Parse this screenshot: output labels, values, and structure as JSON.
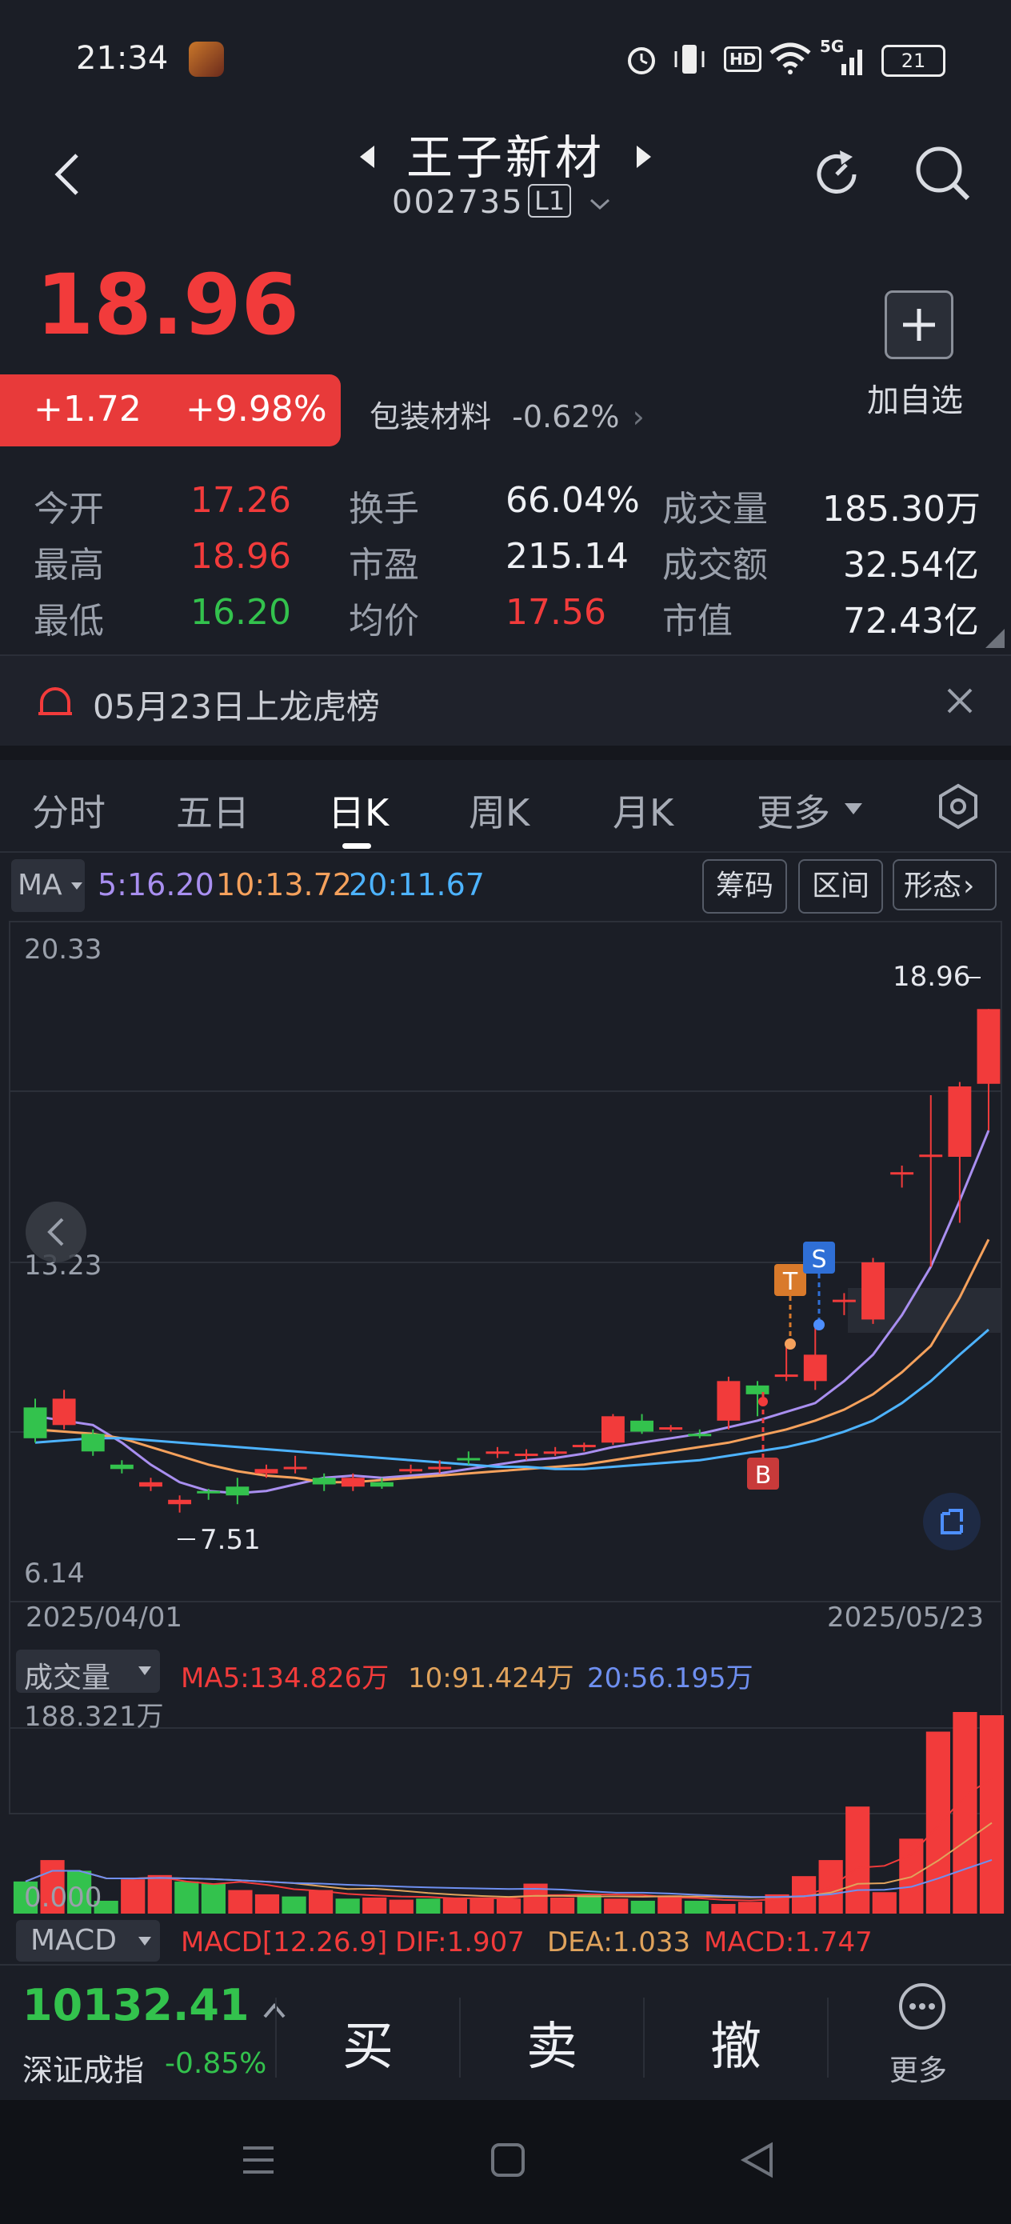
{
  "status_bar": {
    "time": "21:34",
    "network_label": "5G",
    "battery": "21",
    "hd_label": "HD"
  },
  "header": {
    "stock_name": "王子新材",
    "stock_code": "002735",
    "level_badge": "L1"
  },
  "quote": {
    "price": "18.96",
    "change": "+1.72",
    "change_pct": "+9.98%",
    "sector_name": "包装材料",
    "sector_change": "-0.62%",
    "add_watch_label": "加自选"
  },
  "stats": {
    "open_label": "今开",
    "open": "17.26",
    "turnover_label": "换手",
    "turnover": "66.04%",
    "volume_label": "成交量",
    "volume": "185.30万",
    "high_label": "最高",
    "high": "18.96",
    "pe_label": "市盈",
    "pe": "215.14",
    "amount_label": "成交额",
    "amount": "32.54亿",
    "low_label": "最低",
    "low": "16.20",
    "avg_label": "均价",
    "avg": "17.56",
    "mcap_label": "市值",
    "mcap": "72.43亿"
  },
  "notice": {
    "text": "05月23日上龙虎榜"
  },
  "tabs": [
    "分时",
    "五日",
    "日K",
    "周K",
    "月K",
    "更多"
  ],
  "active_tab": "日K",
  "ma_bar": {
    "selector": "MA",
    "ma5": "5:16.20",
    "ma10": "10:13.72",
    "ma20": "20:11.67",
    "btn_chips": "筹码",
    "btn_range": "区间",
    "btn_pattern": "形态"
  },
  "kline": {
    "y_top": "20.33",
    "y_mid": "13.23",
    "y_bottom": "6.14",
    "high_mark": "18.96",
    "low_mark": "7.51",
    "date_start": "2025/04/01",
    "date_end": "2025/05/23",
    "marker_t": "T",
    "marker_s": "S",
    "marker_b": "B"
  },
  "volume_panel": {
    "selector": "成交量",
    "ma5": "MA5:134.826万",
    "ma10": "10:91.424万",
    "ma20": "20:56.195万",
    "top_value": "188.321万",
    "bottom_value": "0.000"
  },
  "macd_panel": {
    "selector": "MACD",
    "params": "MACD[12.26.9]",
    "dif": "DIF:1.907",
    "dea": "DEA:1.033",
    "macd": "MACD:1.747"
  },
  "index_bar": {
    "value": "10132.41",
    "name": "深证成指",
    "change": "-0.85%"
  },
  "actions": {
    "buy": "买",
    "sell": "卖",
    "cancel": "撤",
    "more": "更多"
  },
  "colors": {
    "up": "#f23b3b",
    "down": "#33c24d",
    "ma5": "#a98ff0",
    "ma10": "#f5a15c",
    "ma20": "#4db3ff",
    "background": "#1b1e26"
  },
  "chart_data": {
    "type": "candlestick",
    "title": "",
    "x_range": [
      "2025/04/01",
      "2025/05/23"
    ],
    "ylim": [
      6.14,
      20.33
    ],
    "candles": [
      {
        "o": 9.9,
        "c": 9.2,
        "h": 10.1,
        "l": 9.1
      },
      {
        "o": 9.5,
        "c": 10.1,
        "h": 10.3,
        "l": 9.4
      },
      {
        "o": 9.3,
        "c": 8.9,
        "h": 9.4,
        "l": 8.8
      },
      {
        "o": 8.6,
        "c": 8.5,
        "h": 8.7,
        "l": 8.4
      },
      {
        "o": 8.1,
        "c": 8.2,
        "h": 8.3,
        "l": 8.0
      },
      {
        "o": 7.7,
        "c": 7.8,
        "h": 7.9,
        "l": 7.51
      },
      {
        "o": 8.0,
        "c": 7.95,
        "h": 8.05,
        "l": 7.8
      },
      {
        "o": 8.1,
        "c": 7.9,
        "h": 8.3,
        "l": 7.7
      },
      {
        "o": 8.4,
        "c": 8.5,
        "h": 8.6,
        "l": 8.3
      },
      {
        "o": 8.5,
        "c": 8.55,
        "h": 8.8,
        "l": 8.4
      },
      {
        "o": 8.3,
        "c": 8.15,
        "h": 8.4,
        "l": 8.0
      },
      {
        "o": 8.1,
        "c": 8.3,
        "h": 8.4,
        "l": 8.0
      },
      {
        "o": 8.2,
        "c": 8.1,
        "h": 8.3,
        "l": 8.05
      },
      {
        "o": 8.45,
        "c": 8.5,
        "h": 8.6,
        "l": 8.4
      },
      {
        "o": 8.5,
        "c": 8.55,
        "h": 8.7,
        "l": 8.4
      },
      {
        "o": 8.75,
        "c": 8.7,
        "h": 8.9,
        "l": 8.6
      },
      {
        "o": 8.85,
        "c": 8.9,
        "h": 9.0,
        "l": 8.75
      },
      {
        "o": 8.8,
        "c": 8.85,
        "h": 8.95,
        "l": 8.7
      },
      {
        "o": 8.85,
        "c": 8.9,
        "h": 9.0,
        "l": 8.8
      },
      {
        "o": 9.0,
        "c": 9.05,
        "h": 9.1,
        "l": 8.9
      },
      {
        "o": 9.1,
        "c": 9.7,
        "h": 9.75,
        "l": 9.05
      },
      {
        "o": 9.6,
        "c": 9.35,
        "h": 9.75,
        "l": 9.3
      },
      {
        "o": 9.4,
        "c": 9.45,
        "h": 9.5,
        "l": 9.35
      },
      {
        "o": 9.3,
        "c": 9.25,
        "h": 9.4,
        "l": 9.2
      },
      {
        "o": 9.6,
        "c": 10.5,
        "h": 10.6,
        "l": 9.4
      },
      {
        "o": 10.4,
        "c": 10.2,
        "h": 10.5,
        "l": 9.7
      },
      {
        "o": 10.6,
        "c": 10.65,
        "h": 11.4,
        "l": 10.5
      },
      {
        "o": 10.5,
        "c": 11.1,
        "h": 11.8,
        "l": 10.3
      },
      {
        "o": 12.3,
        "c": 12.35,
        "h": 12.5,
        "l": 12.0
      },
      {
        "o": 11.9,
        "c": 13.2,
        "h": 13.3,
        "l": 11.8
      },
      {
        "o": 15.2,
        "c": 15.25,
        "h": 15.4,
        "l": 14.9
      },
      {
        "o": 15.6,
        "c": 15.65,
        "h": 17.0,
        "l": 13.1
      },
      {
        "o": 15.6,
        "c": 17.2,
        "h": 17.3,
        "l": 14.1
      },
      {
        "o": 17.26,
        "c": 18.96,
        "h": 18.96,
        "l": 16.2
      }
    ],
    "series": [
      {
        "name": "MA5",
        "values": [
          9.7,
          9.6,
          9.5,
          9.1,
          8.6,
          8.2,
          8.0,
          7.95,
          8.0,
          8.15,
          8.3,
          8.35,
          8.3,
          8.35,
          8.4,
          8.5,
          8.6,
          8.7,
          8.75,
          8.85,
          9.0,
          9.1,
          9.2,
          9.3,
          9.45,
          9.6,
          9.8,
          10.0,
          10.5,
          11.1,
          12.0,
          13.1,
          14.6,
          16.2
        ]
      },
      {
        "name": "MA10",
        "values": [
          9.4,
          9.35,
          9.3,
          9.2,
          9.0,
          8.8,
          8.6,
          8.45,
          8.35,
          8.3,
          8.2,
          8.2,
          8.25,
          8.3,
          8.35,
          8.4,
          8.45,
          8.5,
          8.55,
          8.6,
          8.7,
          8.8,
          8.9,
          9.0,
          9.1,
          9.25,
          9.4,
          9.6,
          9.85,
          10.2,
          10.7,
          11.3,
          12.4,
          13.72
        ]
      },
      {
        "name": "MA20",
        "values": [
          9.1,
          9.15,
          9.2,
          9.2,
          9.15,
          9.1,
          9.05,
          9.0,
          8.95,
          8.9,
          8.85,
          8.8,
          8.75,
          8.7,
          8.65,
          8.6,
          8.55,
          8.55,
          8.5,
          8.5,
          8.55,
          8.6,
          8.65,
          8.7,
          8.8,
          8.9,
          9.0,
          9.15,
          9.35,
          9.6,
          10.0,
          10.5,
          11.1,
          11.67
        ]
      }
    ],
    "volume": [
      30,
      50,
      40,
      12,
      32,
      36,
      30,
      28,
      22,
      18,
      16,
      22,
      14,
      15,
      13,
      14,
      15,
      15,
      14,
      28,
      15,
      18,
      14,
      12,
      17,
      12,
      9,
      11,
      18,
      35,
      50,
      100,
      20,
      70,
      170,
      188.321,
      185.3
    ]
  }
}
